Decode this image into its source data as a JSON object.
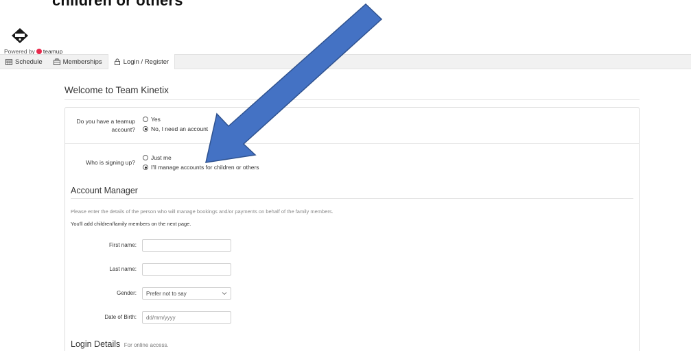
{
  "caption": "children or others”",
  "brand": {
    "powered_prefix": "Powered by",
    "powered_name": "teamup"
  },
  "nav": {
    "tabs": [
      {
        "label": "Schedule",
        "icon": "calendar-icon"
      },
      {
        "label": "Memberships",
        "icon": "membership-icon"
      },
      {
        "label": "Login / Register",
        "icon": "lock-icon",
        "active": true
      }
    ]
  },
  "welcome_title": "Welcome to Team Kinetix",
  "account_question": {
    "label_line1": "Do you have a teamup",
    "label_line2": "account?",
    "options": [
      {
        "label": "Yes",
        "selected": false
      },
      {
        "label": "No, I need an account",
        "selected": true
      }
    ]
  },
  "signup_question": {
    "label": "Who is signing up?",
    "options": [
      {
        "label": "Just me",
        "selected": false
      },
      {
        "label": "I'll manage accounts for children or others",
        "selected": true
      }
    ]
  },
  "account_manager": {
    "title": "Account Manager",
    "note": "Please enter the details of the person who will manage bookings and/or payments on behalf of the family members.",
    "note2": "You'll add children/family members on the next page.",
    "fields": {
      "first_name_label": "First name:",
      "first_name_value": "",
      "last_name_label": "Last name:",
      "last_name_value": "",
      "gender_label": "Gender:",
      "gender_value": "Prefer not to say",
      "dob_label": "Date of Birth:",
      "dob_placeholder": "dd/mm/yyyy"
    }
  },
  "login_details": {
    "title": "Login Details",
    "subtitle": "For online access."
  },
  "colors": {
    "arrow_fill": "#4472c4",
    "arrow_stroke": "#2f528f",
    "brand_red": "#e8294c",
    "nav_bg": "#f1f1f1"
  }
}
